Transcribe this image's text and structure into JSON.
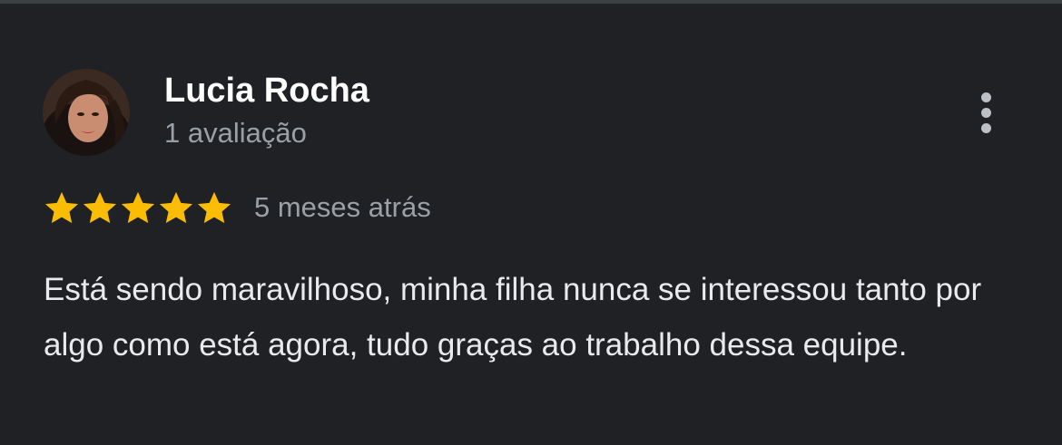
{
  "review": {
    "author_name": "Lucia Rocha",
    "author_reviews": "1 avaliação",
    "rating": 5,
    "rating_max": 5,
    "date": "5 meses atrás",
    "text": "Está sendo maravilhoso, minha filha nunca se interessou tanto por algo como está agora, tudo graças ao trabalho dessa equipe."
  },
  "icons": {
    "star": "star-icon",
    "more": "more-vert-icon"
  },
  "colors": {
    "background": "#202124",
    "star": "#fbbc04",
    "primary_text": "#ffffff",
    "secondary_text": "#9aa0a6",
    "body_text": "#e8eaed"
  }
}
